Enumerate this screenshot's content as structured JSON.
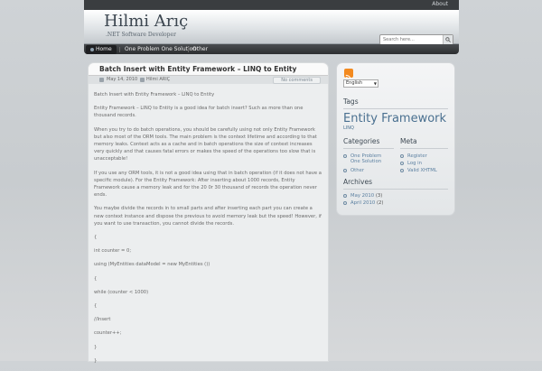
{
  "topbar": {
    "about": "About"
  },
  "header": {
    "title": "Hilmi Arıç",
    "description": ".NET Software Developer",
    "search_placeholder": "Search here..."
  },
  "nav": {
    "items": [
      {
        "label": "Home"
      },
      {
        "label": "One Problem One Solution"
      },
      {
        "label": "Other"
      }
    ]
  },
  "post": {
    "title": "Batch Insert with Entity Framework – LINQ to Entity",
    "date": "May 14, 2010",
    "author": "Hilmi ARIÇ",
    "comments": "No comments",
    "paragraphs": [
      "Batch Insert with Entity Framework – LINQ to Entity",
      "Entity Framework – LINQ to Entity is a good idea for batch insert? Such as more than one thousand records.",
      "When you try to do batch operations, you should be carefully using not only Entity Framework but also most of the ORM tools. The main problem is the context lifetime and according to that memory leaks. Context acts as a cache and in batch operations the size of context increases very quickly and that causes fatal errors or makes the speed of the operations too slow that is unacceptable!",
      "If you use any ORM tools, it is not a good idea using that in batch operation (if it does not have a specific module). For the Entity Framework: After inserting about 1000 records, Entity Framework cause a memory leak and for the 20 0r 30 thousand of records the operation never ends.",
      "You maybe divide the records in to small parts and after inserting each part you can create a new context instance and dispose the previous to avoid  memory leak but the speed! However, if you want to use transaction, you cannot divide the records.",
      "{",
      "int counter = 0;",
      "using (MyEntities dataModel = new MyEntities ())",
      "{",
      "while (counter < 1000)",
      "{",
      "//Insert",
      "counter++;",
      "}",
      "}"
    ]
  },
  "sidebar": {
    "language": "English",
    "tags_heading": "Tags",
    "tag_big": "Entity Framework",
    "tag_small": "LINQ",
    "categories_heading": "Categories",
    "categories": [
      "One Problem One Solution",
      "Other"
    ],
    "meta_heading": "Meta",
    "meta": [
      "Register",
      "Log in",
      "Valid XHTML"
    ],
    "archives_heading": "Archives",
    "archives": [
      {
        "label": "May 2010",
        "count": "(3)"
      },
      {
        "label": "April 2010",
        "count": "(2)"
      }
    ]
  },
  "colors": {
    "accent": "#4a7090",
    "link": "#5a7fa0",
    "nav_bg": "#2c2e30"
  }
}
